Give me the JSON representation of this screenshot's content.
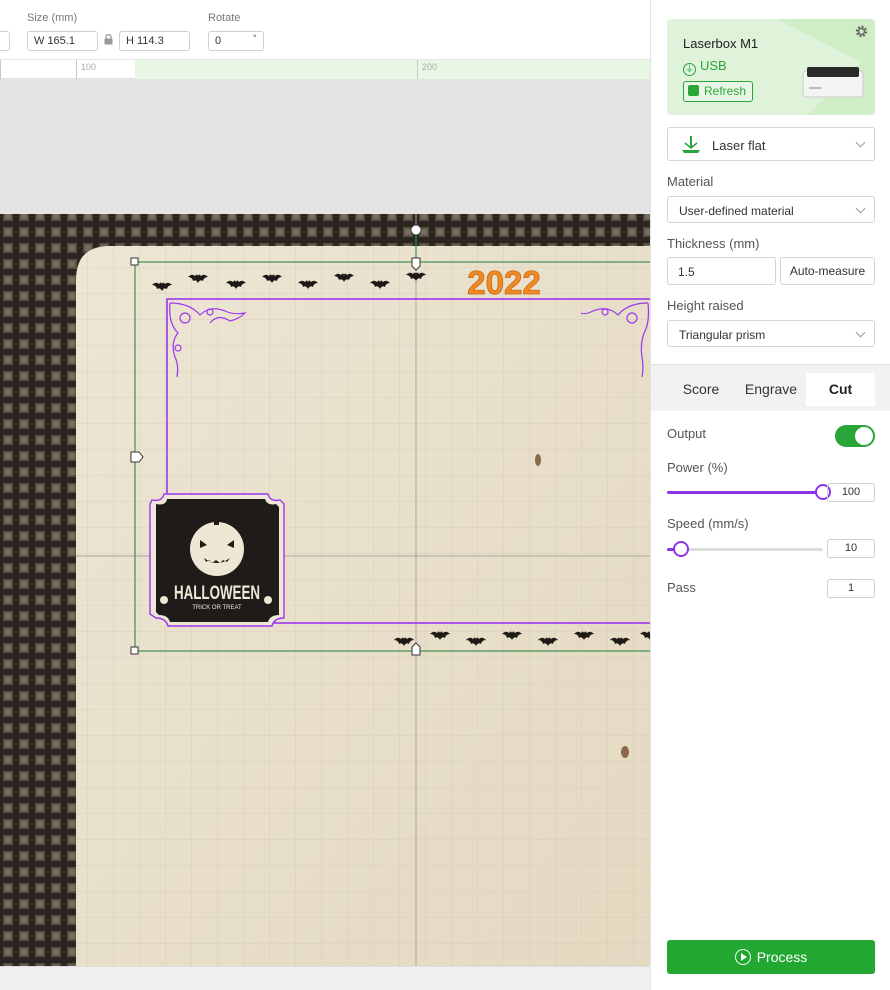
{
  "toolbar": {
    "size_label": "Size (mm)",
    "width_value": "W 165.1",
    "height_value": "H 114.3",
    "rotate_label": "Rotate",
    "rotate_value": "0",
    "rotate_unit": "°"
  },
  "ruler": {
    "ticks": [
      "100",
      "200"
    ]
  },
  "canvas": {
    "year_text": "2022",
    "halloween_text": "HALLOWEEN",
    "halloween_subtext": "TRICK OR TREAT"
  },
  "device": {
    "name": "Laserbox M1",
    "connection": "USB",
    "refresh_label": "Refresh"
  },
  "mode": {
    "selected": "Laser flat"
  },
  "material": {
    "label": "Material",
    "selected": "User-defined material"
  },
  "thickness": {
    "label": "Thickness (mm)",
    "value": "1.5",
    "auto_label": "Auto-measure"
  },
  "height_raised": {
    "label": "Height raised",
    "selected": "Triangular prism"
  },
  "tabs": [
    {
      "label": "Score"
    },
    {
      "label": "Engrave"
    },
    {
      "label": "Cut",
      "active": true
    }
  ],
  "settings": {
    "output_label": "Output",
    "output_on": true,
    "power_label": "Power (%)",
    "power_value": "100",
    "power_fraction": 1.0,
    "speed_label": "Speed (mm/s)",
    "speed_value": "10",
    "speed_fraction": 0.09,
    "pass_label": "Pass",
    "pass_value": "1"
  },
  "process_label": "Process",
  "colors": {
    "accent_green": "#22a830",
    "accent_purple": "#8f33e8",
    "selection_green": "#3f8f4f",
    "year_orange": "#f08a24"
  }
}
